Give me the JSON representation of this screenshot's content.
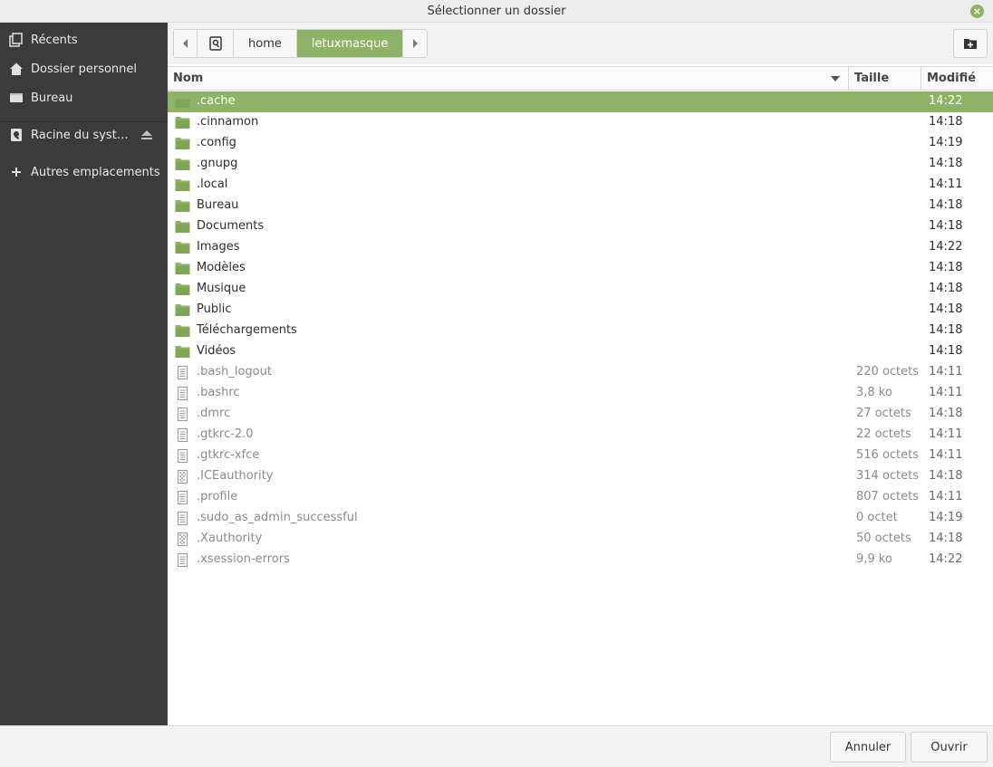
{
  "window": {
    "title": "Sélectionner un dossier",
    "close_icon": "close-icon"
  },
  "colors": {
    "accent": "#8fb366",
    "sidebar_bg": "#3b3b3b",
    "folder": "#8fb366"
  },
  "sidebar": {
    "items": [
      {
        "label": "Récents",
        "icon": "recent-icon"
      },
      {
        "label": "Dossier personnel",
        "icon": "home-icon"
      },
      {
        "label": "Bureau",
        "icon": "desktop-icon"
      },
      {
        "label": "Racine du syst…",
        "icon": "drive-icon",
        "eject": true
      },
      {
        "label": "Autres emplacements",
        "icon": "plus-icon"
      }
    ]
  },
  "pathbar": {
    "segments": [
      "home",
      "letuxmasque"
    ],
    "active_segment": "letuxmasque"
  },
  "columns": {
    "name": "Nom",
    "size": "Taille",
    "modified": "Modifié",
    "sort": "descending"
  },
  "files": [
    {
      "name": ".cache",
      "type": "folder",
      "size": "",
      "modified": "14:22",
      "selected": true
    },
    {
      "name": ".cinnamon",
      "type": "folder",
      "size": "",
      "modified": "14:18"
    },
    {
      "name": ".config",
      "type": "folder",
      "size": "",
      "modified": "14:19"
    },
    {
      "name": ".gnupg",
      "type": "folder",
      "size": "",
      "modified": "14:18"
    },
    {
      "name": ".local",
      "type": "folder",
      "size": "",
      "modified": "14:11"
    },
    {
      "name": "Bureau",
      "type": "folder",
      "size": "",
      "modified": "14:18"
    },
    {
      "name": "Documents",
      "type": "folder",
      "size": "",
      "modified": "14:18"
    },
    {
      "name": "Images",
      "type": "folder",
      "size": "",
      "modified": "14:22"
    },
    {
      "name": "Modèles",
      "type": "folder",
      "size": "",
      "modified": "14:18"
    },
    {
      "name": "Musique",
      "type": "folder",
      "size": "",
      "modified": "14:18"
    },
    {
      "name": "Public",
      "type": "folder",
      "size": "",
      "modified": "14:18"
    },
    {
      "name": "Téléchargements",
      "type": "folder",
      "size": "",
      "modified": "14:18"
    },
    {
      "name": "Vidéos",
      "type": "folder",
      "size": "",
      "modified": "14:18"
    },
    {
      "name": ".bash_logout",
      "type": "text",
      "size": "220 octets",
      "modified": "14:11"
    },
    {
      "name": ".bashrc",
      "type": "text",
      "size": "3,8 ko",
      "modified": "14:11"
    },
    {
      "name": ".dmrc",
      "type": "text",
      "size": "27 octets",
      "modified": "14:18"
    },
    {
      "name": ".gtkrc-2.0",
      "type": "text",
      "size": "22 octets",
      "modified": "14:11"
    },
    {
      "name": ".gtkrc-xfce",
      "type": "text",
      "size": "516 octets",
      "modified": "14:11"
    },
    {
      "name": ".ICEauthority",
      "type": "binary",
      "size": "314 octets",
      "modified": "14:18"
    },
    {
      "name": ".profile",
      "type": "text",
      "size": "807 octets",
      "modified": "14:11"
    },
    {
      "name": ".sudo_as_admin_successful",
      "type": "text",
      "size": "0 octet",
      "modified": "14:19"
    },
    {
      "name": ".Xauthority",
      "type": "binary",
      "size": "50 octets",
      "modified": "14:18"
    },
    {
      "name": ".xsession-errors",
      "type": "text",
      "size": "9,9 ko",
      "modified": "14:22"
    }
  ],
  "actions": {
    "cancel": "Annuler",
    "open": "Ouvrir"
  }
}
